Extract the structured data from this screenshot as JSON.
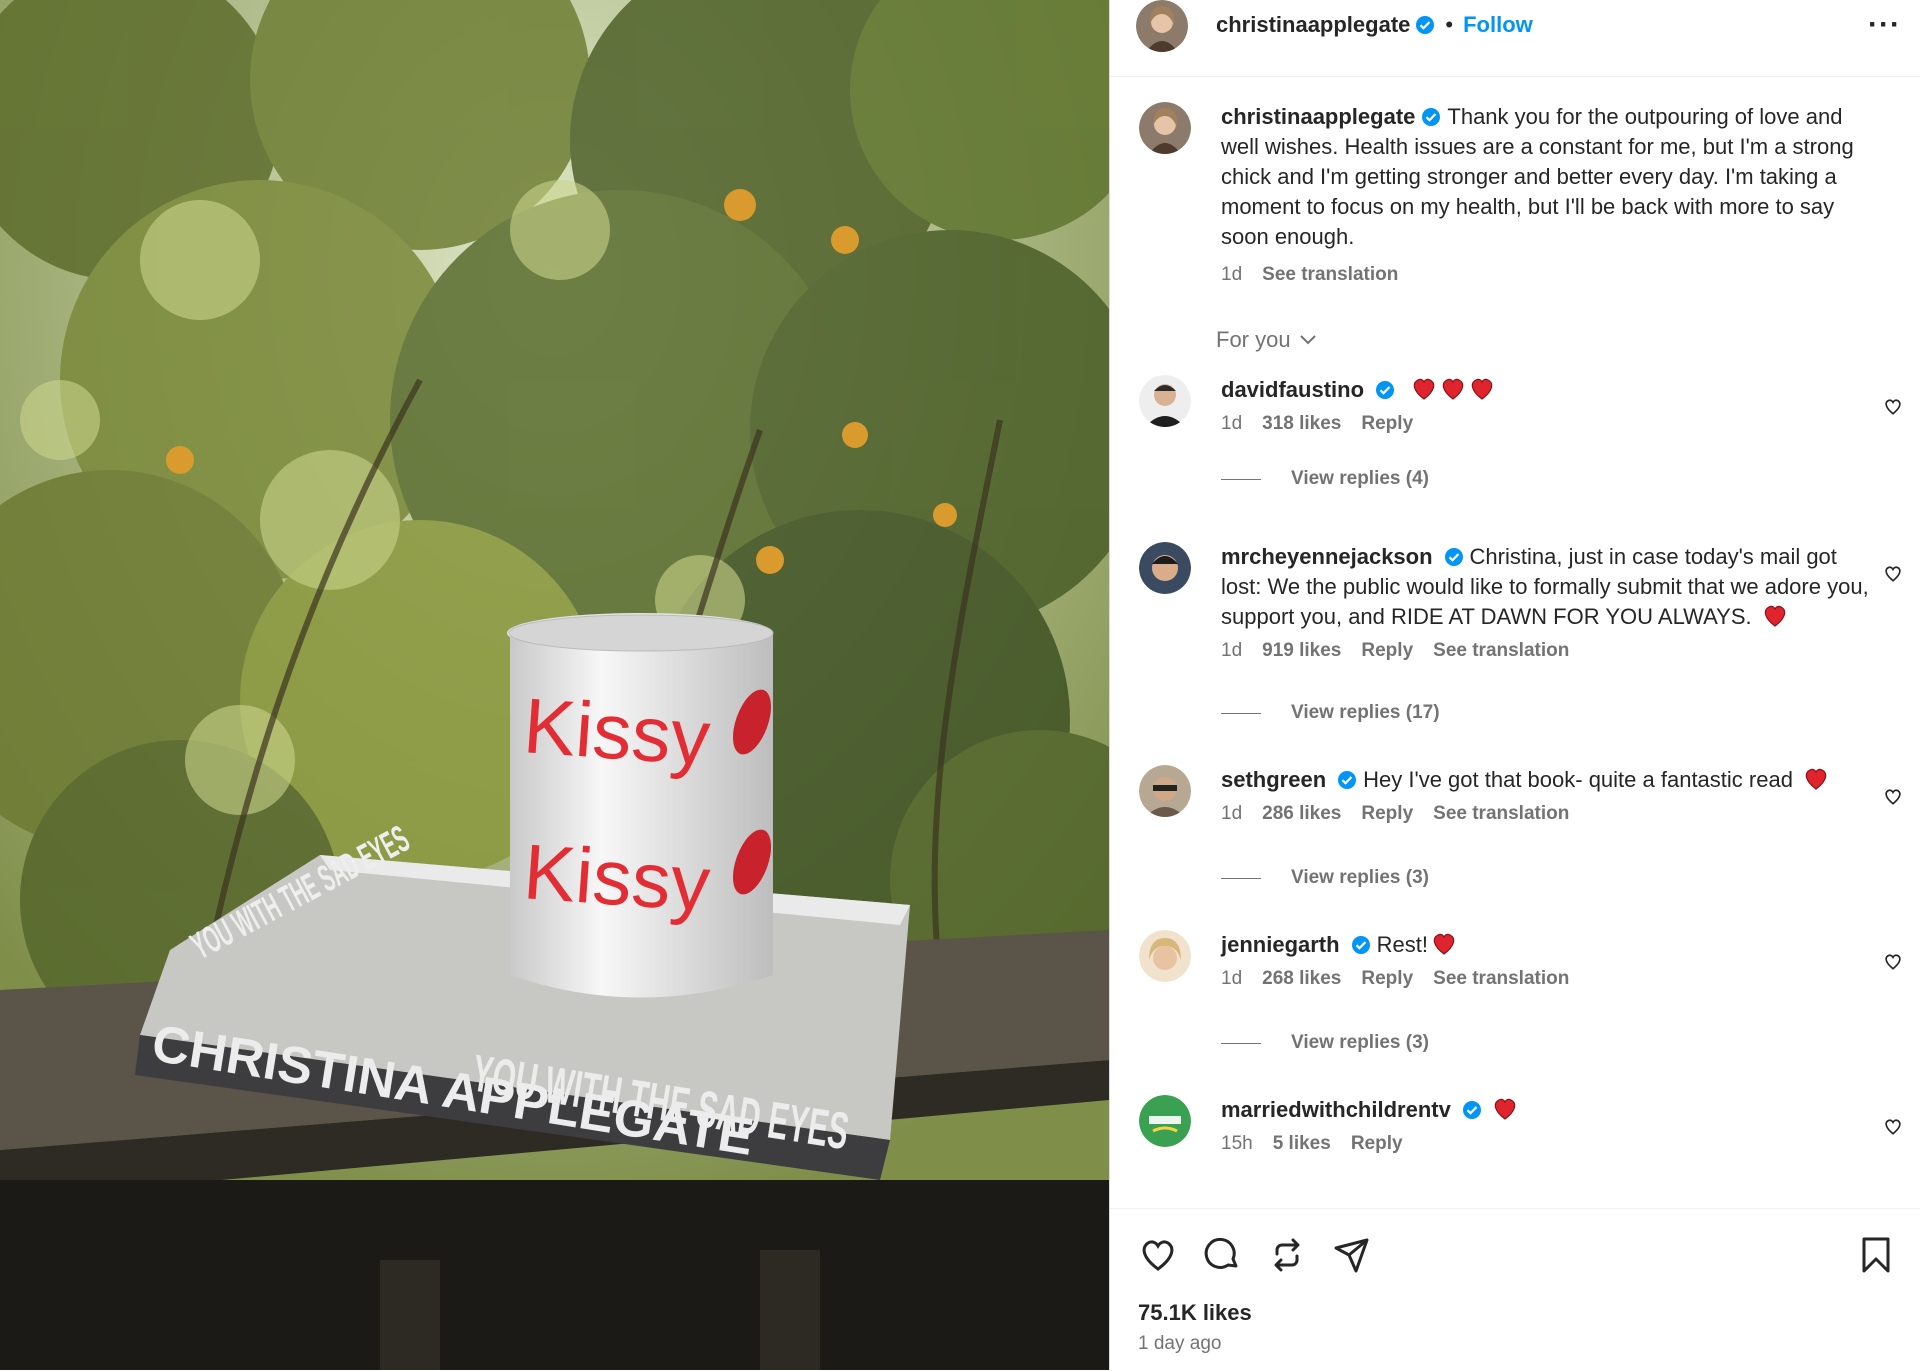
{
  "post": {
    "author": "christinaapplegate",
    "follow_label": "Follow",
    "more_label": "···",
    "caption": "Thank you for the outpouring of love and well wishes. Health issues are a constant for me, but I'm a strong chick and I'm getting stronger and better every day. I'm taking a moment to focus on my health, but I'll be back with more to say soon enough.",
    "caption_time": "1d",
    "caption_translate": "See translation",
    "sort_label": "For you",
    "likes": "75.1K likes",
    "time_ago": "1 day ago"
  },
  "image": {
    "mug_text_1": "Kissy",
    "mug_text_2": "Kissy",
    "book_spine_author": "CHRISTINA APPLEGATE",
    "book_spine_title": "YOU WITH THE SAD EYES",
    "book_cover_title": "YOU WITH THE SAD EYES"
  },
  "comments": [
    {
      "user": "davidfaustino",
      "text": "",
      "hearts": 3,
      "time": "1d",
      "likes": "318 likes",
      "reply": "Reply",
      "translate": "",
      "view_replies": "View replies (4)"
    },
    {
      "user": "mrcheyennejackson",
      "text": "Christina, just in case today's mail got lost: We the public would like to formally submit that we adore you, support you, and RIDE AT DAWN FOR YOU ALWAYS.",
      "hearts": 1,
      "time": "1d",
      "likes": "919 likes",
      "reply": "Reply",
      "translate": "See translation",
      "view_replies": "View replies (17)"
    },
    {
      "user": "sethgreen",
      "text": "Hey I've got that book- quite a fantastic read",
      "hearts": 1,
      "time": "1d",
      "likes": "286 likes",
      "reply": "Reply",
      "translate": "See translation",
      "view_replies": "View replies (3)"
    },
    {
      "user": "jenniegarth",
      "text": "Rest!",
      "hearts": 1,
      "time": "1d",
      "likes": "268 likes",
      "reply": "Reply",
      "translate": "See translation",
      "view_replies": "View replies (3)"
    },
    {
      "user": "marriedwithchildrentv",
      "text": "",
      "hearts": 1,
      "time": "15h",
      "likes": "5 likes",
      "reply": "Reply",
      "translate": "",
      "view_replies": ""
    }
  ],
  "colors": {
    "accent": "#0095f6",
    "heart": "#ff3040",
    "muted": "#737373"
  }
}
